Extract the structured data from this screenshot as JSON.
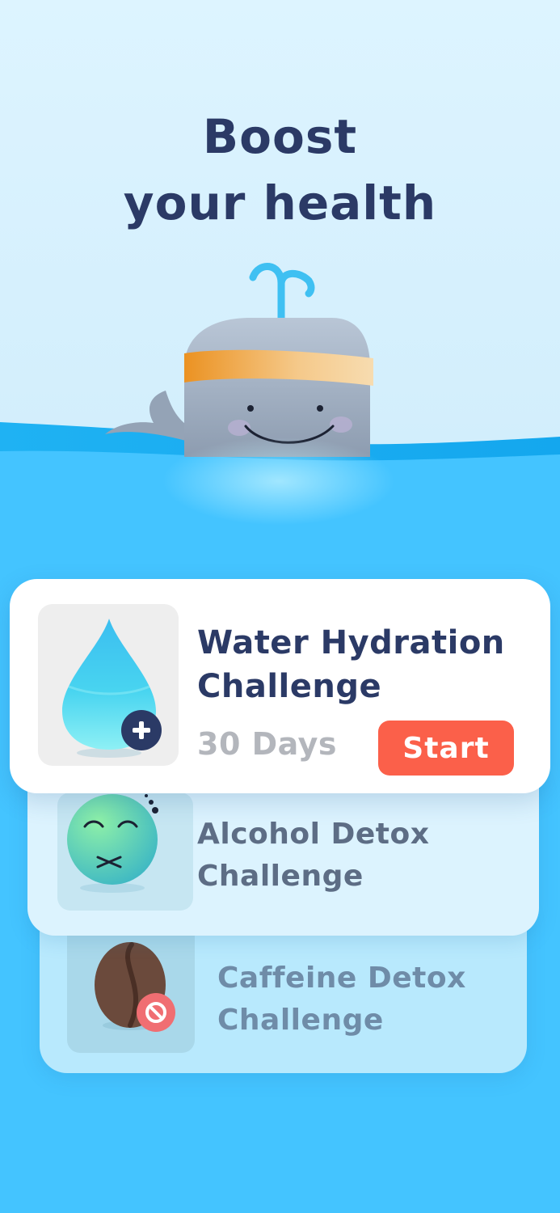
{
  "headline": {
    "line1": "Boost",
    "line2": "your health"
  },
  "challenges": [
    {
      "title_line1": "Water Hydration",
      "title_line2": "Challenge",
      "duration": "30 Days",
      "action_label": "Start",
      "icon": "water-drop-add-icon"
    },
    {
      "title_line1": "Alcohol Detox",
      "title_line2": "Challenge",
      "icon": "dizzy-face-icon"
    },
    {
      "title_line1": "Caffeine Detox",
      "title_line2": "Challenge",
      "icon": "coffee-bean-no-icon"
    }
  ],
  "colors": {
    "sky": "#d8f2fe",
    "sea": "#44c4ff",
    "headline": "#2b3a66",
    "start_button": "#fb604a",
    "whale": "#9cabbd",
    "headband": "#f0a030"
  }
}
